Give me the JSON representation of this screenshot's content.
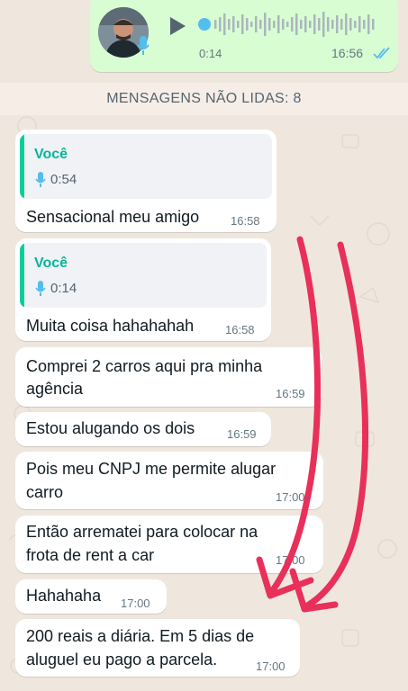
{
  "voice_note": {
    "duration": "0:14",
    "time": "16:56",
    "status_icon": "double-check-read",
    "colors": {
      "bubble": "#d9fdd3",
      "accent": "#53bdeb",
      "play": "#54656f"
    }
  },
  "unread_banner": {
    "label": "MENSAGENS NÃO LIDAS: 8"
  },
  "messages": [
    {
      "quote": {
        "author": "Você",
        "icon": "mic-icon",
        "duration": "0:54"
      },
      "text": "Sensacional meu amigo",
      "time": "16:58"
    },
    {
      "quote": {
        "author": "Você",
        "icon": "mic-icon",
        "duration": "0:14"
      },
      "text": "Muita coisa hahahahah",
      "time": "16:58"
    },
    {
      "text_lines": [
        "Comprei 2 carros aqui pra minha",
        "agência"
      ],
      "time": "16:59"
    },
    {
      "text": "Estou alugando os dois",
      "time": "16:59"
    },
    {
      "text_lines": [
        "Pois meu CNPJ me permite alugar",
        "carro"
      ],
      "time": "17:00"
    },
    {
      "text_lines": [
        "Então arrematei para colocar na",
        "frota de rent a car"
      ],
      "time": "17:00"
    },
    {
      "text": "Hahahaha",
      "time": "17:00"
    },
    {
      "text_lines": [
        "200 reais a diária. Em 5 dias de",
        "aluguel eu pago a parcela."
      ],
      "time": "17:00"
    }
  ],
  "annotation": {
    "type": "red-arrows",
    "color": "#e8305a",
    "count": 2
  },
  "colors": {
    "chat_bg": "#efe7de",
    "quote_accent": "#06cf9c",
    "incoming_bubble": "#ffffff"
  }
}
